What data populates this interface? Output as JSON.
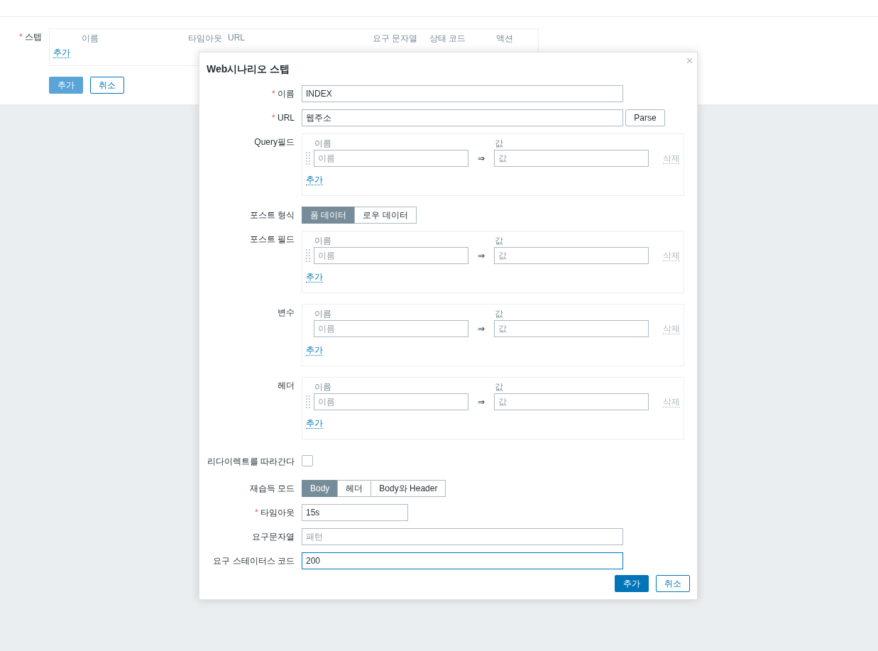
{
  "page": {
    "steps": {
      "label": "스텝",
      "required_mark": "*",
      "columns": [
        "이름",
        "타임아웃",
        "URL",
        "요구 문자열",
        "상태 코드",
        "액션"
      ],
      "add_link": "추가"
    },
    "buttons": [
      {
        "label": "추가",
        "kind": "primary"
      },
      {
        "label": "취소",
        "kind": "secondary"
      }
    ]
  },
  "dialog": {
    "title": "Web시나리오 스텝",
    "close": "×",
    "rows": [
      {
        "kind": "input",
        "label": "이름",
        "required_mark": "*",
        "value": "INDEX"
      },
      {
        "kind": "input",
        "label": "URL",
        "required_mark": "*",
        "value": "웹주소",
        "button": "Parse"
      },
      {
        "kind": "pairs",
        "label": "Query필드",
        "name_header": "이름",
        "value_header": "값",
        "draggable": true,
        "name_placeholder": "이름",
        "arrow": "⇒",
        "value_placeholder": "값",
        "remove": "삭제",
        "add": "추가"
      },
      {
        "kind": "segmented",
        "label": "포스트 형식",
        "options": [
          {
            "label": "폼 데이터",
            "selected": true
          },
          {
            "label": "로우 데이터",
            "selected": false
          }
        ]
      },
      {
        "kind": "pairs",
        "label": "포스트 필드",
        "name_header": "이름",
        "value_header": "값",
        "draggable": true,
        "name_placeholder": "이름",
        "arrow": "⇒",
        "value_placeholder": "값",
        "remove": "삭제",
        "add": "추가"
      },
      {
        "kind": "pairs",
        "label": "변수",
        "name_header": "이름",
        "value_header": "값",
        "draggable": false,
        "name_placeholder": "이름",
        "arrow": "⇒",
        "value_placeholder": "값",
        "remove": "삭제",
        "add": "추가"
      },
      {
        "kind": "pairs",
        "label": "헤더",
        "name_header": "이름",
        "value_header": "값",
        "draggable": true,
        "name_placeholder": "이름",
        "arrow": "⇒",
        "value_placeholder": "값",
        "remove": "삭제",
        "add": "추가"
      },
      {
        "kind": "checkbox",
        "label": "리다이렉트를 따라간다",
        "checked": false
      },
      {
        "kind": "segmented",
        "label": "재습득 모드",
        "options": [
          {
            "label": "Body",
            "selected": true
          },
          {
            "label": "헤더",
            "selected": false
          },
          {
            "label": "Body와 Header",
            "selected": false
          }
        ]
      },
      {
        "kind": "short-input",
        "label": "타임아웃",
        "required_mark": "*",
        "value": "15s"
      },
      {
        "kind": "input",
        "label": "요구문자열",
        "placeholder": "패턴"
      },
      {
        "kind": "input",
        "label": "요구 스테이터스 코드",
        "value": "200",
        "focused": true
      }
    ],
    "buttons": [
      {
        "label": "추가",
        "kind": "primary"
      },
      {
        "label": "취소",
        "kind": "secondary"
      }
    ]
  }
}
